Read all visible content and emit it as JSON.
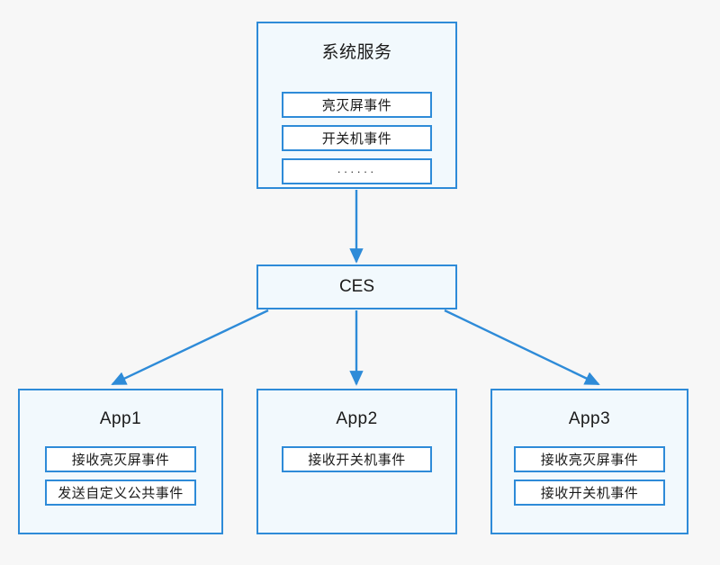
{
  "diagram": {
    "background_color": "#f7f7f7",
    "accent_color": "#2E8BD8",
    "node_fill": "#f2f9fd",
    "item_fill": "#ffffff",
    "nodes": {
      "system_service": {
        "title": "系统服务",
        "items": [
          {
            "label": "亮灭屏事件"
          },
          {
            "label": "开关机事件"
          },
          {
            "label": "······"
          }
        ]
      },
      "ces": {
        "title": "CES"
      },
      "app1": {
        "title": "App1",
        "items": [
          {
            "label": "接收亮灭屏事件"
          },
          {
            "label": "发送自定义公共事件"
          }
        ]
      },
      "app2": {
        "title": "App2",
        "items": [
          {
            "label": "接收开关机事件"
          }
        ]
      },
      "app3": {
        "title": "App3",
        "items": [
          {
            "label": "接收亮灭屏事件"
          },
          {
            "label": "接收开关机事件"
          }
        ]
      }
    },
    "connectors": [
      {
        "name": "system-service-to-ces",
        "from": "system_service",
        "to": "ces"
      },
      {
        "name": "ces-to-app1",
        "from": "ces",
        "to": "app1"
      },
      {
        "name": "ces-to-app2",
        "from": "ces",
        "to": "app2"
      },
      {
        "name": "ces-to-app3",
        "from": "ces",
        "to": "app3"
      }
    ]
  }
}
